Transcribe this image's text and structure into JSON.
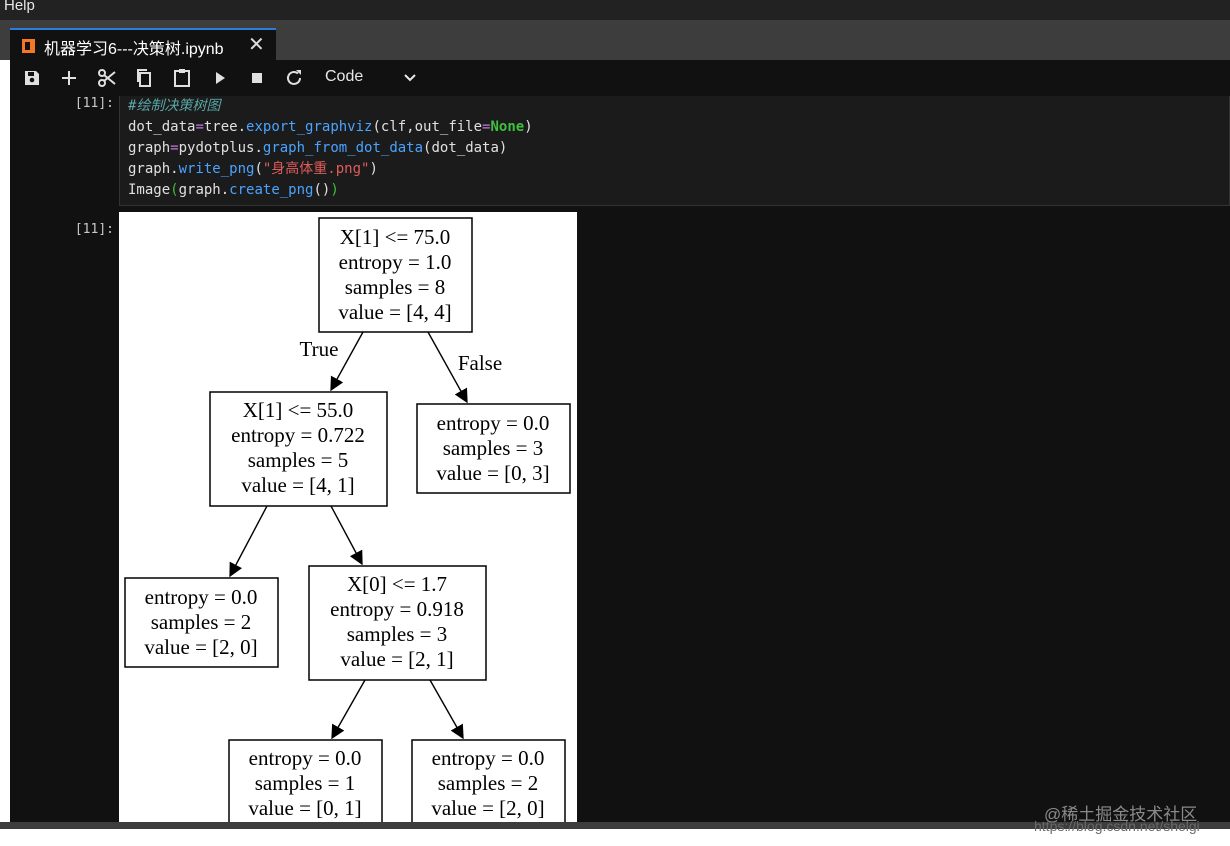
{
  "menu": {
    "help": "Help"
  },
  "tab": {
    "title": "机器学习6---决策树.ipynb",
    "close": "✕"
  },
  "toolbar": {
    "cell_type": "Code"
  },
  "cell": {
    "input_prompt": "[11]:",
    "output_prompt": "[11]:",
    "code": {
      "line1": "#绘制决策树图",
      "line2": {
        "a": "dot_data",
        "b": "=",
        "c": "tree.",
        "d": "export_graphviz",
        "e": "(clf,out_file",
        "f": "=",
        "g": "None",
        "h": ")"
      },
      "line3": {
        "a": "graph",
        "b": "=",
        "c": "pydotplus.",
        "d": "graph_from_dot_data",
        "e": "(dot_data)"
      },
      "line4": {
        "a": "graph.",
        "b": "write_png",
        "c": "(",
        "d": "\"身高体重.png\"",
        "e": ")"
      },
      "line5": {
        "a": "Image",
        "b": "(",
        "c": "graph.",
        "d": "create_png",
        "e": "()",
        "f": ")"
      }
    }
  },
  "tree": {
    "nodes": [
      {
        "lines": [
          "X[1] <= 75.0",
          "entropy = 1.0",
          "samples = 8",
          "value = [4, 4]"
        ]
      },
      {
        "lines": [
          "X[1] <= 55.0",
          "entropy = 0.722",
          "samples = 5",
          "value = [4, 1]"
        ]
      },
      {
        "lines": [
          "entropy = 0.0",
          "samples = 3",
          "value = [0, 3]"
        ]
      },
      {
        "lines": [
          "entropy = 0.0",
          "samples = 2",
          "value = [2, 0]"
        ]
      },
      {
        "lines": [
          "X[0] <= 1.7",
          "entropy = 0.918",
          "samples = 3",
          "value = [2, 1]"
        ]
      },
      {
        "lines": [
          "entropy = 0.0",
          "samples = 1",
          "value = [0, 1]"
        ]
      },
      {
        "lines": [
          "entropy = 0.0",
          "samples = 2",
          "value = [2, 0]"
        ]
      }
    ],
    "edge_true": "True",
    "edge_false": "False"
  },
  "watermark": {
    "line1": "@稀土掘金技术社区",
    "line2": "https://blog.csdn.net/shelgi"
  }
}
